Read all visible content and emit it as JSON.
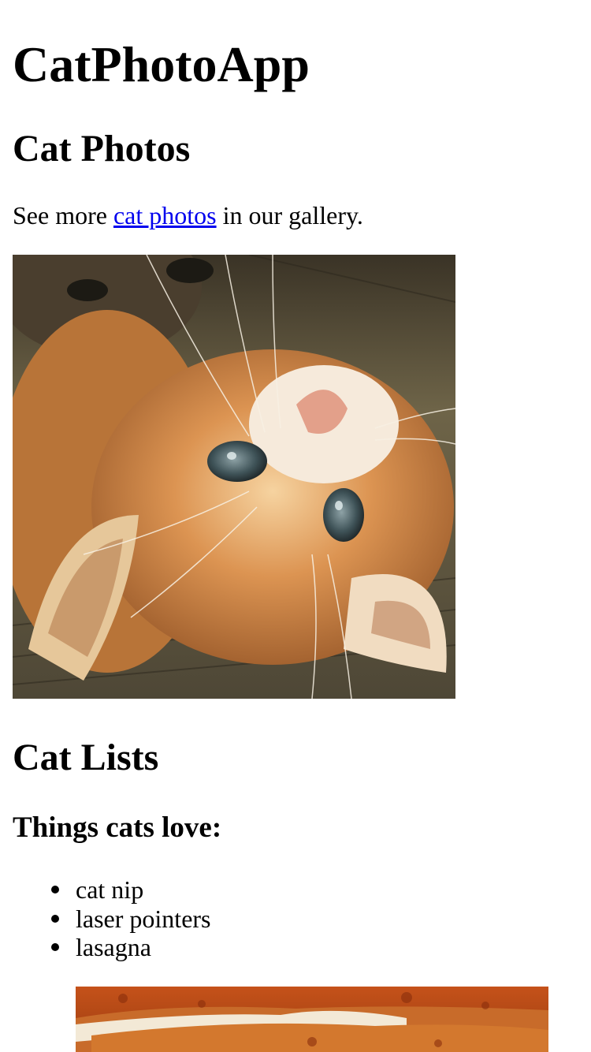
{
  "header": {
    "app_title": "CatPhotoApp"
  },
  "photos_section": {
    "title": "Cat Photos",
    "intro_before": "See more ",
    "intro_link": "cat photos",
    "intro_after": " in our gallery.",
    "photo_icon": "orange-kitten-photo"
  },
  "lists_section": {
    "title": "Cat Lists",
    "subtitle": "Things cats love:",
    "items": [
      {
        "label": "cat nip"
      },
      {
        "label": "laser pointers"
      },
      {
        "label": "lasagna"
      }
    ],
    "photo_icon": "lasagna-photo"
  },
  "colors": {
    "link": "#0000ee",
    "text": "#000000",
    "background": "#ffffff"
  }
}
